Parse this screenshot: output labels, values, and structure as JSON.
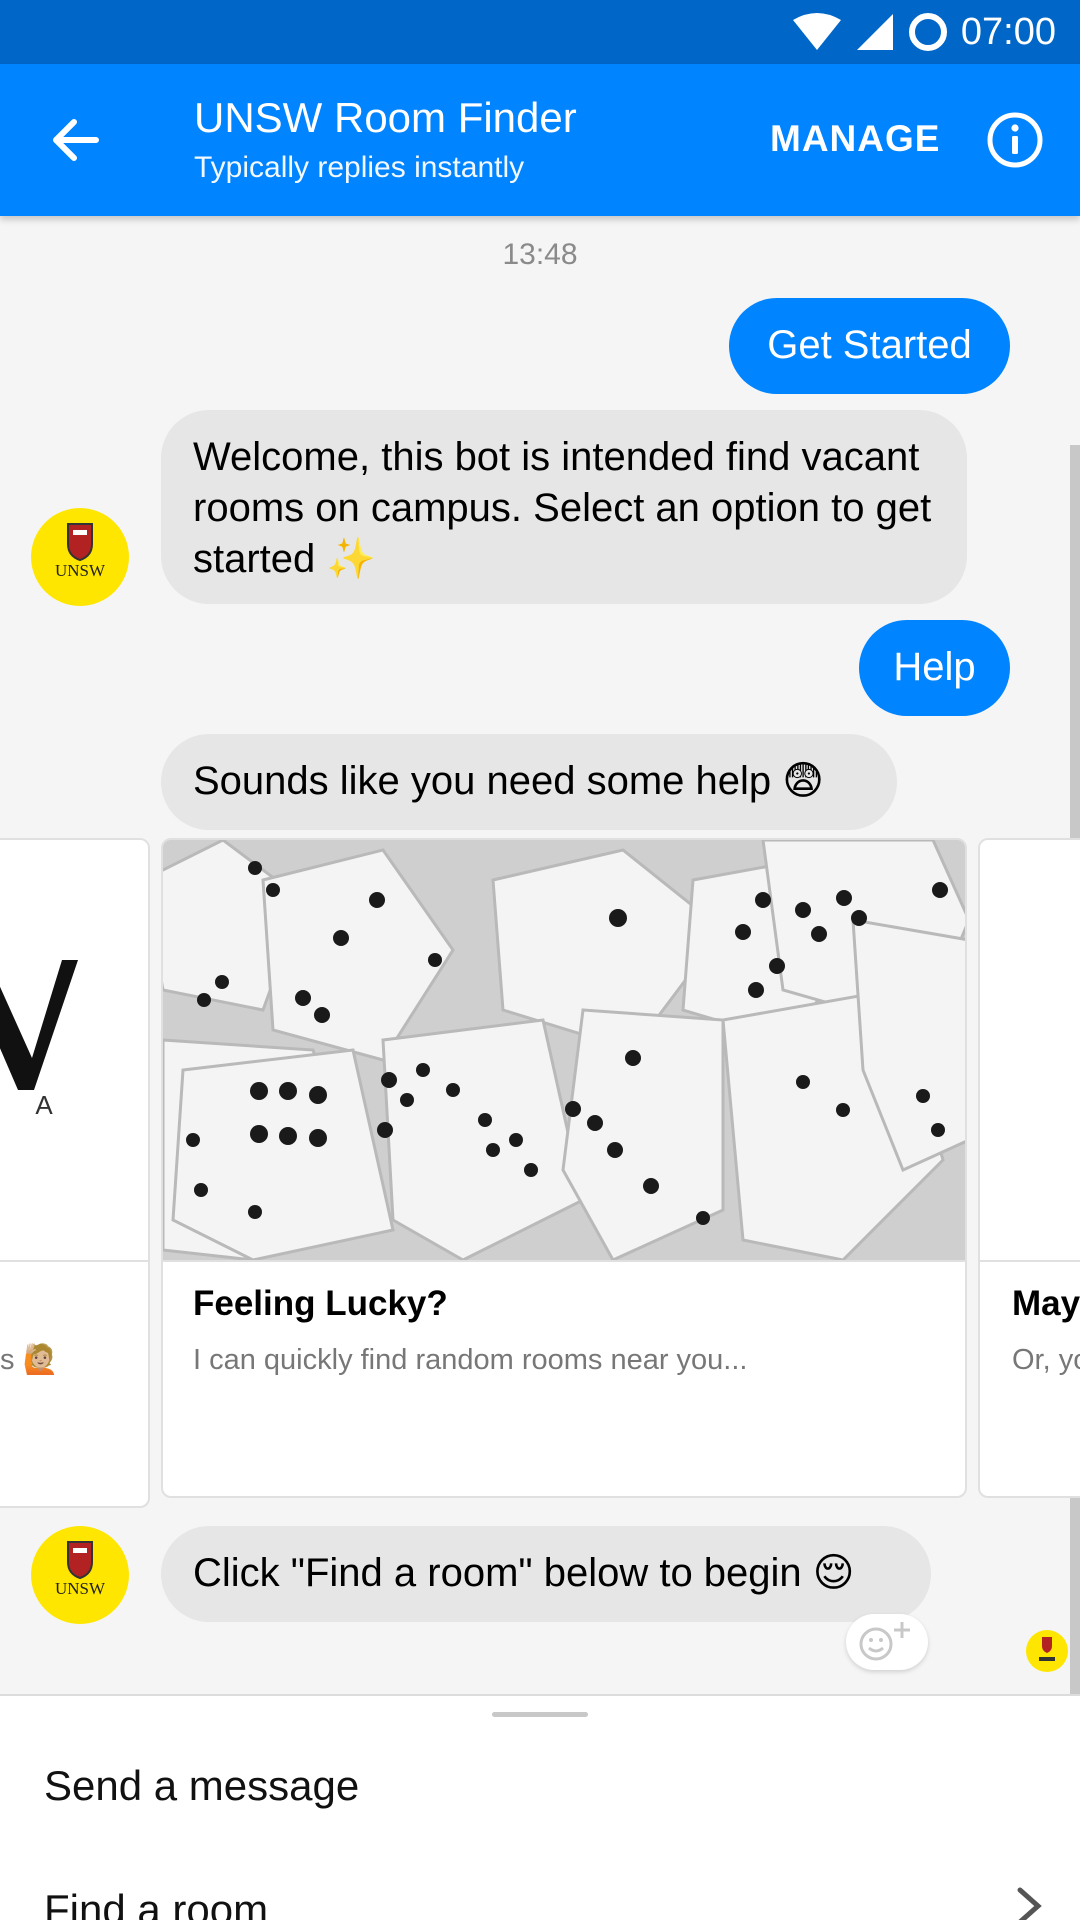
{
  "status_bar": {
    "time": "07:00"
  },
  "header": {
    "title": "UNSW Room Finder",
    "subtitle": "Typically replies instantly",
    "manage_label": "MANAGE"
  },
  "chat": {
    "timestamp": "13:48",
    "messages": [
      {
        "from": "user",
        "text": "Get Started"
      },
      {
        "from": "bot",
        "text": "Welcome, this bot is intended find vacant rooms on campus. Select an option to get started ✨"
      },
      {
        "from": "user",
        "text": "Help"
      },
      {
        "from": "bot",
        "text": "Sounds like you need some help 😨"
      },
      {
        "from": "bot",
        "text": "Click \"Find a room\" below to begin 😌"
      }
    ],
    "cards": [
      {
        "title": "",
        "subtitle": "s 🙋🏼"
      },
      {
        "title": "Feeling Lucky?",
        "subtitle": "I can quickly find random rooms near you..."
      },
      {
        "title": "May",
        "subtitle": "Or, yo"
      }
    ]
  },
  "avatar_text": "UNSW",
  "composer": {
    "placeholder": "Send a message",
    "quick_reply": "Find a room"
  },
  "colors": {
    "brand_blue": "#0084ff",
    "status_blue": "#0066c8",
    "avatar_yellow": "#ffe600"
  }
}
